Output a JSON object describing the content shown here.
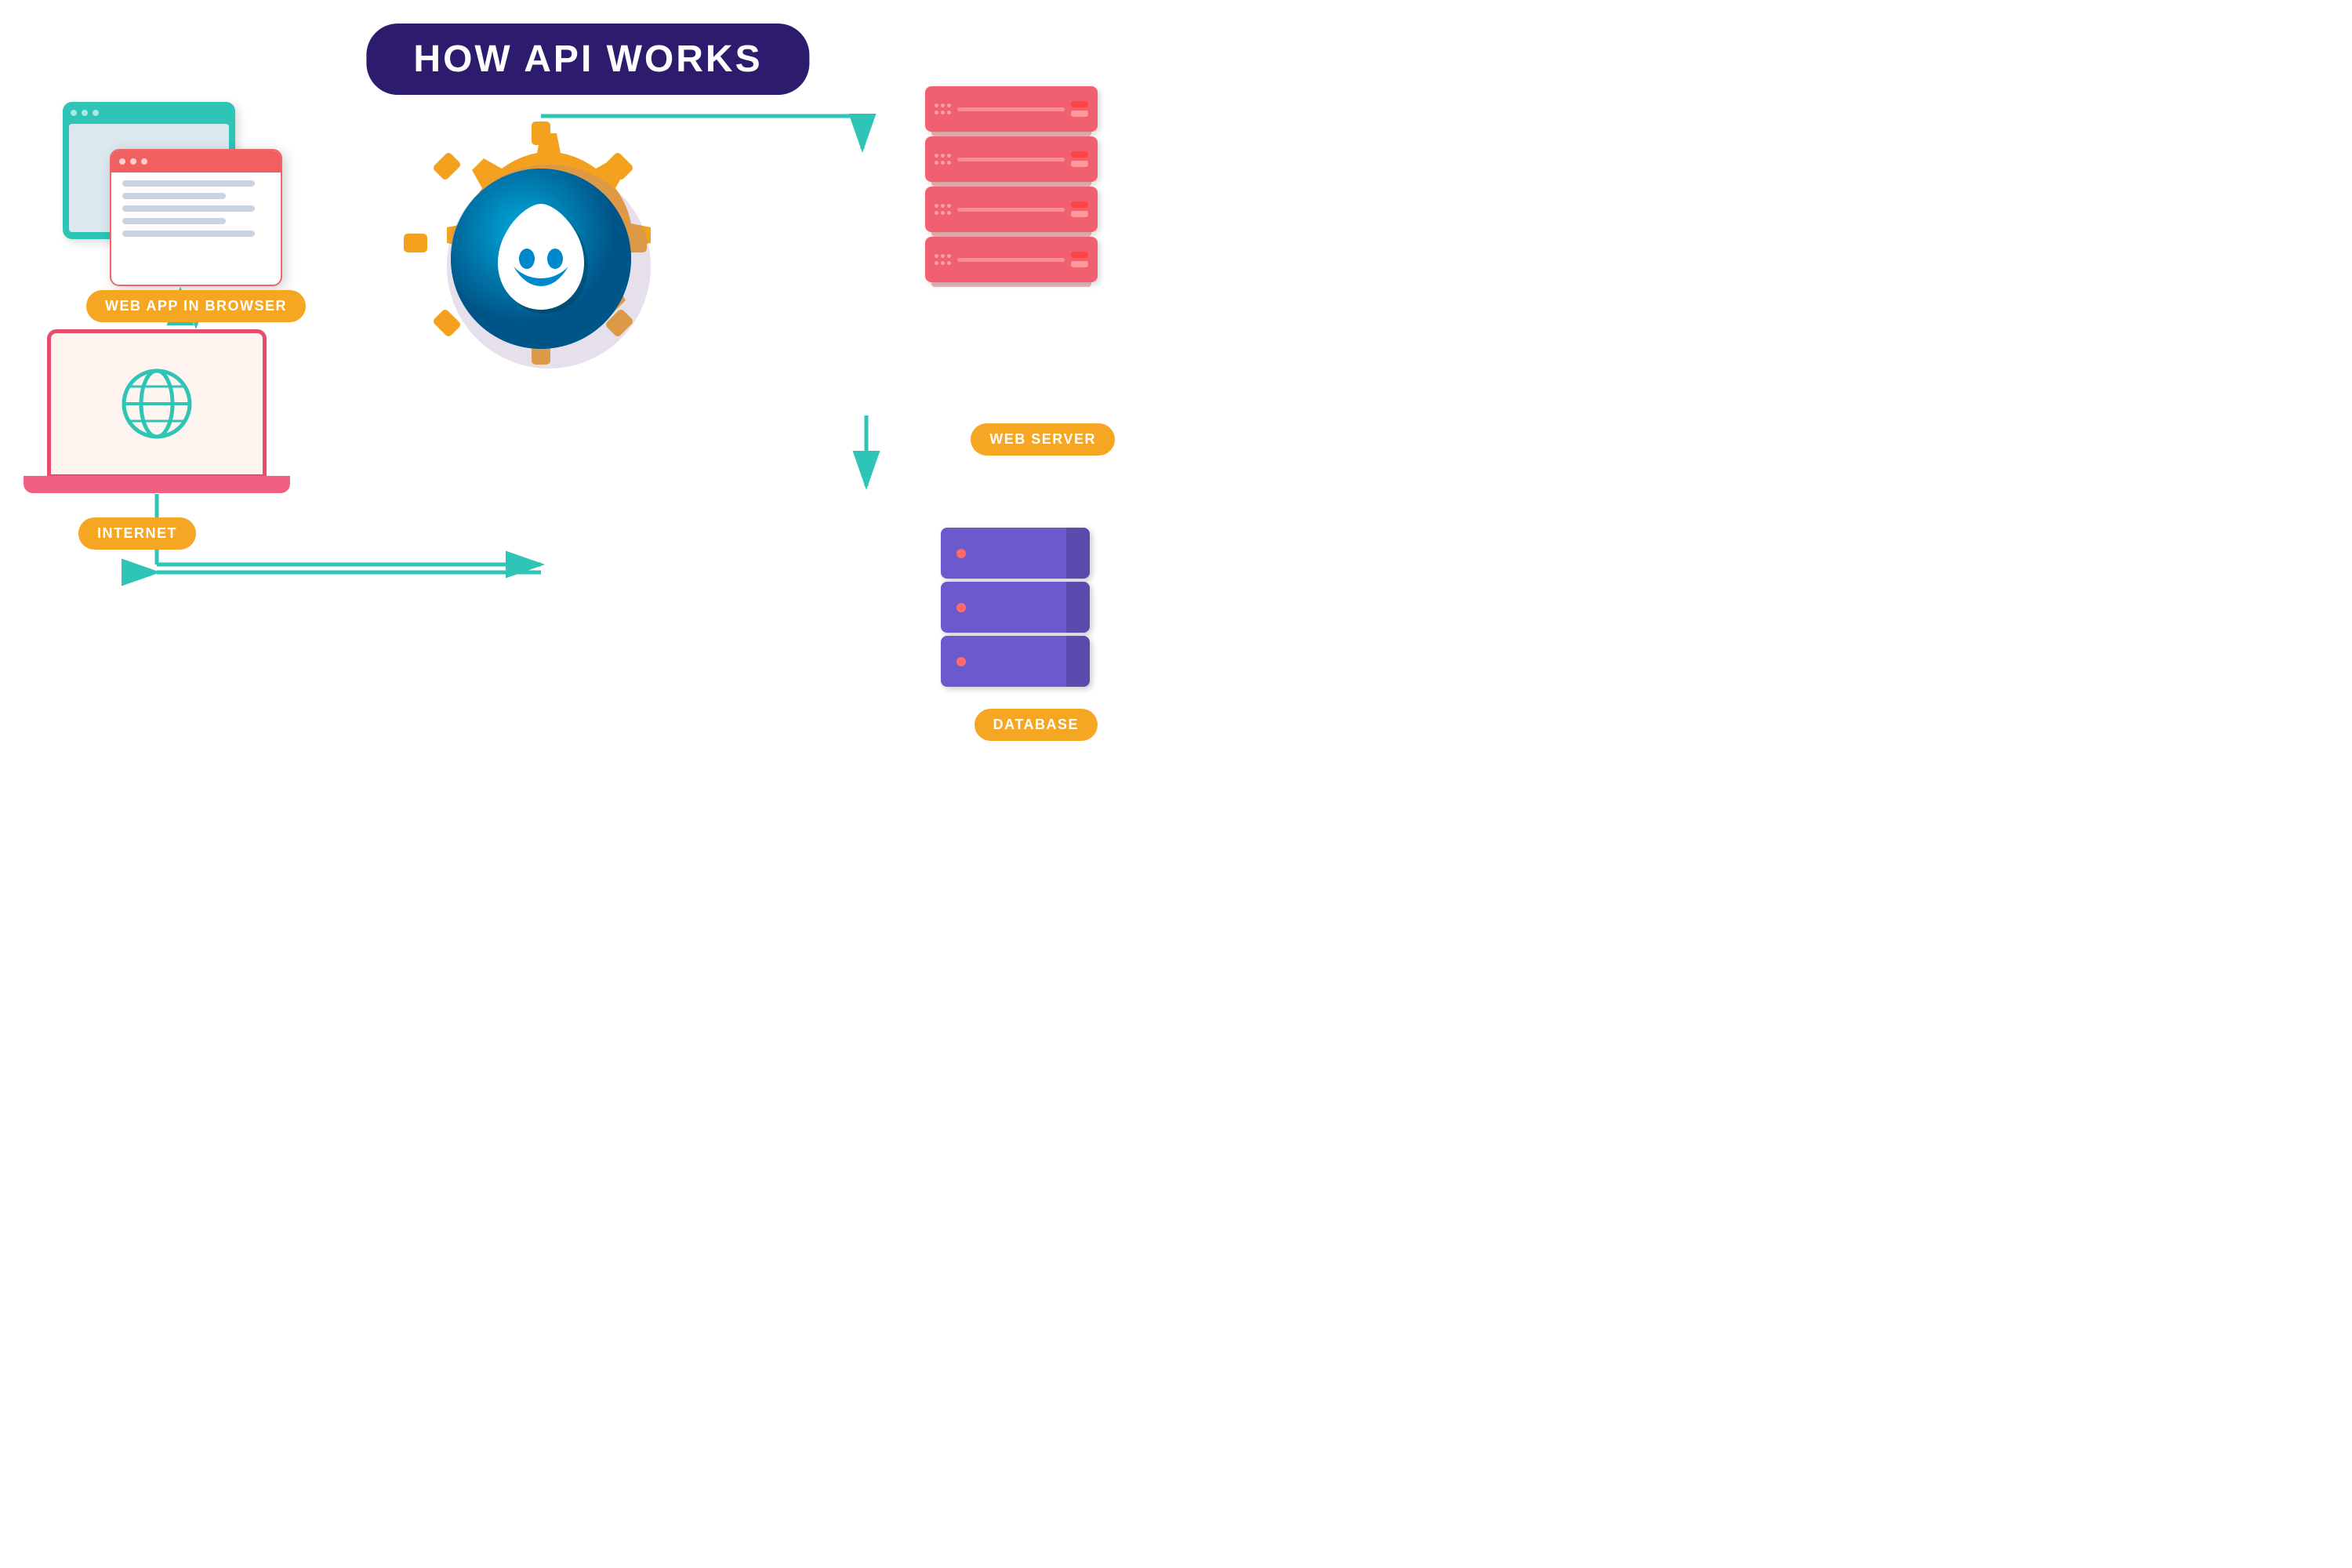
{
  "title": "HOW API WORKS",
  "labels": {
    "web_app": "WEB APP IN BROWSER",
    "internet": "INTERNET",
    "web_server": "WEB SERVER",
    "database": "DATABASE"
  },
  "colors": {
    "title_bg": "#2d1b6e",
    "teal": "#2ec4b6",
    "orange": "#f5a623",
    "red": "#e84c6c",
    "purple": "#6a5acd",
    "gear_fill": "#f5a120",
    "drupal_blue": "#0077c0"
  },
  "server_units": [
    {
      "id": 1
    },
    {
      "id": 2
    },
    {
      "id": 3
    },
    {
      "id": 4
    }
  ]
}
